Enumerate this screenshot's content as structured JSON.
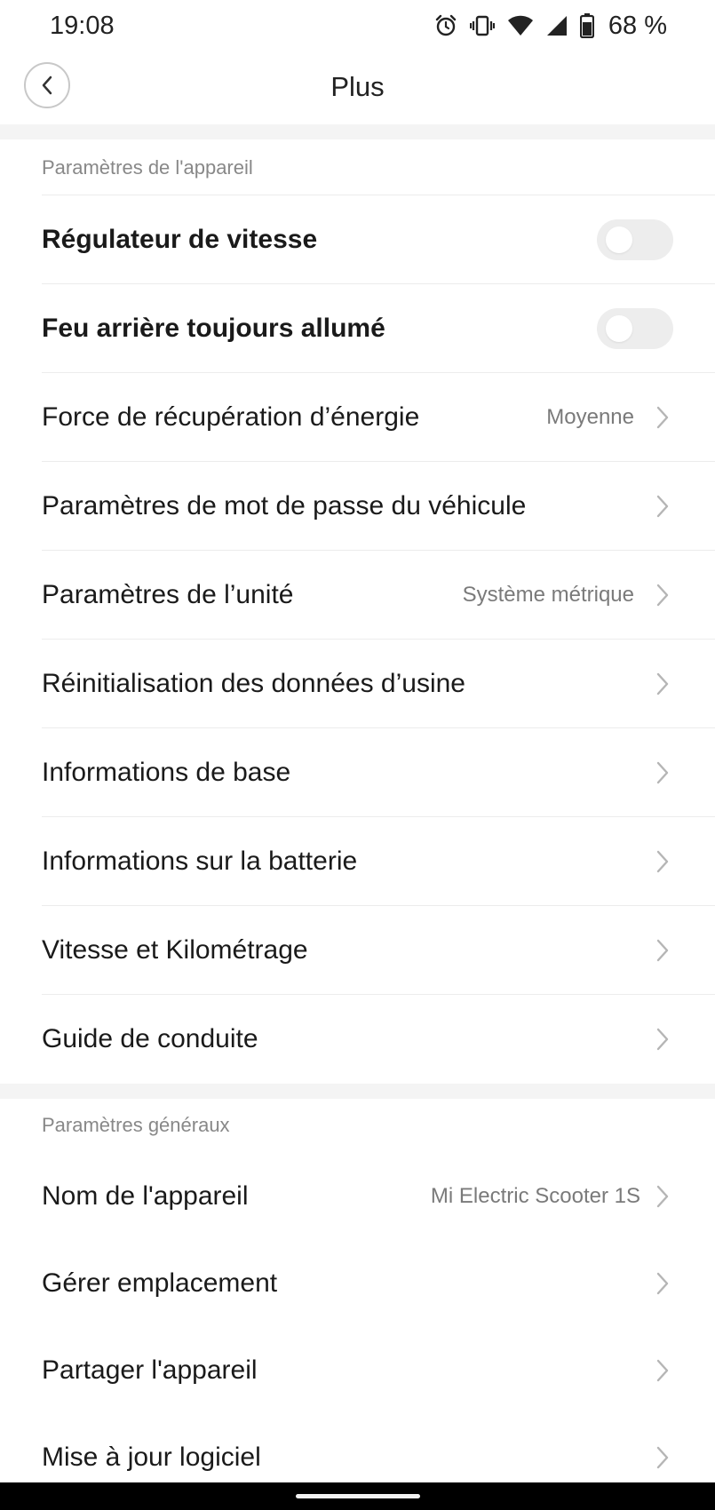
{
  "status_bar": {
    "time": "19:08",
    "battery_percent": "68 %",
    "icons": [
      "alarm-icon",
      "vibrate-icon",
      "wifi-icon",
      "signal-icon",
      "battery-icon"
    ]
  },
  "header": {
    "title": "Plus",
    "back_icon": "chevron-left-icon"
  },
  "device_section": {
    "title": "Paramètres de l'appareil",
    "cruise_control": {
      "label": "Régulateur de vitesse",
      "enabled": false
    },
    "tail_light": {
      "label": "Feu arrière toujours allumé",
      "enabled": false
    },
    "energy_recovery": {
      "label": "Force de récupération d’énergie",
      "value": "Moyenne"
    },
    "password": {
      "label": "Paramètres de mot de passe du véhicule"
    },
    "unit": {
      "label": "Paramètres de l’unité",
      "value": "Système métrique"
    },
    "factory_reset": {
      "label": "Réinitialisation des données d’usine"
    },
    "basic_info": {
      "label": "Informations de base"
    },
    "battery_info": {
      "label": "Informations sur la batterie"
    },
    "speed_mileage": {
      "label": "Vitesse et Kilométrage"
    },
    "riding_guide": {
      "label": "Guide de conduite"
    }
  },
  "general_section": {
    "title": "Paramètres généraux",
    "device_name": {
      "label": "Nom de l'appareil",
      "value": "Mi Electric Scooter 1S"
    },
    "manage_location": {
      "label": "Gérer emplacement"
    },
    "share_device": {
      "label": "Partager l'appareil"
    },
    "firmware_update": {
      "label": "Mise à jour logiciel"
    }
  },
  "colors": {
    "background": "#ffffff",
    "separator": "#f4f4f4",
    "text": "#1a1a1a",
    "secondary_text": "#7a7a7a",
    "toggle_off": "#ededed"
  }
}
